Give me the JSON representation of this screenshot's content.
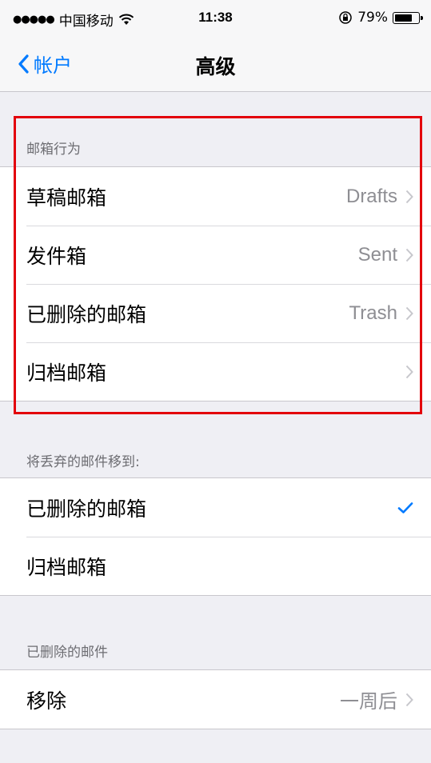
{
  "status": {
    "carrier": "中国移动",
    "time": "11:38",
    "battery": "79%",
    "battery_level": 0.79
  },
  "nav": {
    "back_label": "帐户",
    "title": "高级"
  },
  "mailbox_behaviors": {
    "header": "邮箱行为",
    "rows": [
      {
        "label": "草稿邮箱",
        "value": "Drafts"
      },
      {
        "label": "发件箱",
        "value": "Sent"
      },
      {
        "label": "已删除的邮箱",
        "value": "Trash"
      },
      {
        "label": "归档邮箱",
        "value": ""
      }
    ]
  },
  "discard": {
    "header": "将丢弃的邮件移到:",
    "rows": [
      {
        "label": "已删除的邮箱",
        "selected": true
      },
      {
        "label": "归档邮箱",
        "selected": false
      }
    ]
  },
  "deleted": {
    "header": "已删除的邮件",
    "rows": [
      {
        "label": "移除",
        "value": "一周后"
      }
    ]
  },
  "colors": {
    "accent": "#007aff",
    "highlight": "#e3000b"
  }
}
